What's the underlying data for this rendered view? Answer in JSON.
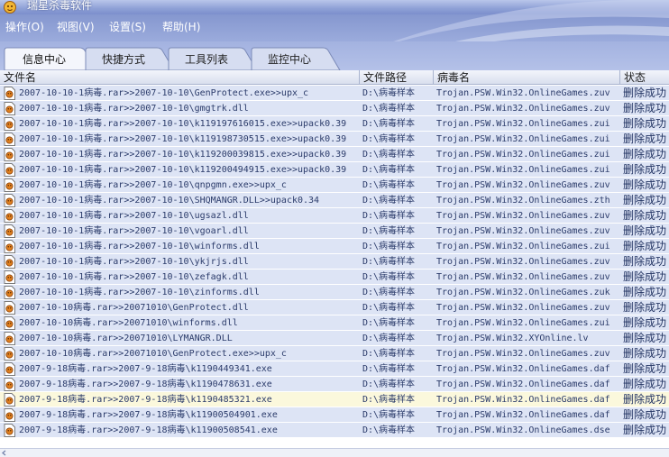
{
  "window": {
    "title": "瑞星杀毒软件",
    "app_icon": "rising-lion-icon"
  },
  "menu": {
    "items": [
      {
        "label": "操作(O)"
      },
      {
        "label": "视图(V)"
      },
      {
        "label": "设置(S)"
      },
      {
        "label": "帮助(H)"
      }
    ]
  },
  "tabs": [
    {
      "label": "信息中心",
      "active": true
    },
    {
      "label": "快捷方式",
      "active": false
    },
    {
      "label": "工具列表",
      "active": false
    },
    {
      "label": "监控中心",
      "active": false
    }
  ],
  "table": {
    "columns": [
      "文件名",
      "文件路径",
      "病毒名",
      "状态"
    ],
    "rows": [
      {
        "file": "2007-10-10-1病毒.rar>>2007-10-10\\GenProtect.exe>>upx_c",
        "path": "D:\\病毒样本",
        "virus": "Trojan.PSW.Win32.OnlineGames.zuv",
        "status": "删除成功"
      },
      {
        "file": "2007-10-10-1病毒.rar>>2007-10-10\\gmgtrk.dll",
        "path": "D:\\病毒样本",
        "virus": "Trojan.PSW.Win32.OnlineGames.zuv",
        "status": "删除成功"
      },
      {
        "file": "2007-10-10-1病毒.rar>>2007-10-10\\k119197616015.exe>>upack0.39",
        "path": "D:\\病毒样本",
        "virus": "Trojan.PSW.Win32.OnlineGames.zui",
        "status": "删除成功"
      },
      {
        "file": "2007-10-10-1病毒.rar>>2007-10-10\\k119198730515.exe>>upack0.39",
        "path": "D:\\病毒样本",
        "virus": "Trojan.PSW.Win32.OnlineGames.zui",
        "status": "删除成功"
      },
      {
        "file": "2007-10-10-1病毒.rar>>2007-10-10\\k119200039815.exe>>upack0.39",
        "path": "D:\\病毒样本",
        "virus": "Trojan.PSW.Win32.OnlineGames.zui",
        "status": "删除成功"
      },
      {
        "file": "2007-10-10-1病毒.rar>>2007-10-10\\k119200494915.exe>>upack0.39",
        "path": "D:\\病毒样本",
        "virus": "Trojan.PSW.Win32.OnlineGames.zui",
        "status": "删除成功"
      },
      {
        "file": "2007-10-10-1病毒.rar>>2007-10-10\\qnpgmn.exe>>upx_c",
        "path": "D:\\病毒样本",
        "virus": "Trojan.PSW.Win32.OnlineGames.zuv",
        "status": "删除成功"
      },
      {
        "file": "2007-10-10-1病毒.rar>>2007-10-10\\SHQMANGR.DLL>>upack0.34",
        "path": "D:\\病毒样本",
        "virus": "Trojan.PSW.Win32.OnlineGames.zth",
        "status": "删除成功"
      },
      {
        "file": "2007-10-10-1病毒.rar>>2007-10-10\\ugsazl.dll",
        "path": "D:\\病毒样本",
        "virus": "Trojan.PSW.Win32.OnlineGames.zuv",
        "status": "删除成功"
      },
      {
        "file": "2007-10-10-1病毒.rar>>2007-10-10\\vgoarl.dll",
        "path": "D:\\病毒样本",
        "virus": "Trojan.PSW.Win32.OnlineGames.zuv",
        "status": "删除成功"
      },
      {
        "file": "2007-10-10-1病毒.rar>>2007-10-10\\winforms.dll",
        "path": "D:\\病毒样本",
        "virus": "Trojan.PSW.Win32.OnlineGames.zui",
        "status": "删除成功"
      },
      {
        "file": "2007-10-10-1病毒.rar>>2007-10-10\\ykjrjs.dll",
        "path": "D:\\病毒样本",
        "virus": "Trojan.PSW.Win32.OnlineGames.zuv",
        "status": "删除成功"
      },
      {
        "file": "2007-10-10-1病毒.rar>>2007-10-10\\zefagk.dll",
        "path": "D:\\病毒样本",
        "virus": "Trojan.PSW.Win32.OnlineGames.zuv",
        "status": "删除成功"
      },
      {
        "file": "2007-10-10-1病毒.rar>>2007-10-10\\zinforms.dll",
        "path": "D:\\病毒样本",
        "virus": "Trojan.PSW.Win32.OnlineGames.zuk",
        "status": "删除成功"
      },
      {
        "file": "2007-10-10病毒.rar>>20071010\\GenProtect.dll",
        "path": "D:\\病毒样本",
        "virus": "Trojan.PSW.Win32.OnlineGames.zuv",
        "status": "删除成功"
      },
      {
        "file": "2007-10-10病毒.rar>>20071010\\winforms.dll",
        "path": "D:\\病毒样本",
        "virus": "Trojan.PSW.Win32.OnlineGames.zui",
        "status": "删除成功"
      },
      {
        "file": "2007-10-10病毒.rar>>20071010\\LYMANGR.DLL",
        "path": "D:\\病毒样本",
        "virus": "Trojan.PSW.Win32.XYOnline.lv",
        "status": "删除成功"
      },
      {
        "file": "2007-10-10病毒.rar>>20071010\\GenProtect.exe>>upx_c",
        "path": "D:\\病毒样本",
        "virus": "Trojan.PSW.Win32.OnlineGames.zuv",
        "status": "删除成功"
      },
      {
        "file": "2007-9-18病毒.rar>>2007-9-18病毒\\k1190449341.exe",
        "path": "D:\\病毒样本",
        "virus": "Trojan.PSW.Win32.OnlineGames.daf",
        "status": "删除成功"
      },
      {
        "file": "2007-9-18病毒.rar>>2007-9-18病毒\\k1190478631.exe",
        "path": "D:\\病毒样本",
        "virus": "Trojan.PSW.Win32.OnlineGames.daf",
        "status": "删除成功"
      },
      {
        "file": "2007-9-18病毒.rar>>2007-9-18病毒\\k1190485321.exe",
        "path": "D:\\病毒样本",
        "virus": "Trojan.PSW.Win32.OnlineGames.daf",
        "status": "删除成功",
        "highlighted": true
      },
      {
        "file": "2007-9-18病毒.rar>>2007-9-18病毒\\k11900504901.exe",
        "path": "D:\\病毒样本",
        "virus": "Trojan.PSW.Win32.OnlineGames.daf",
        "status": "删除成功"
      },
      {
        "file": "2007-9-18病毒.rar>>2007-9-18病毒\\k11900508541.exe",
        "path": "D:\\病毒样本",
        "virus": "Trojan.PSW.Win32.OnlineGames.dse",
        "status": "删除成功"
      }
    ]
  },
  "colors": {
    "titlebar": "#8ea0d6",
    "row_bg": "#dde4f5",
    "row_highlight": "#fbf8dc",
    "row_text": "#2b3b6a"
  }
}
